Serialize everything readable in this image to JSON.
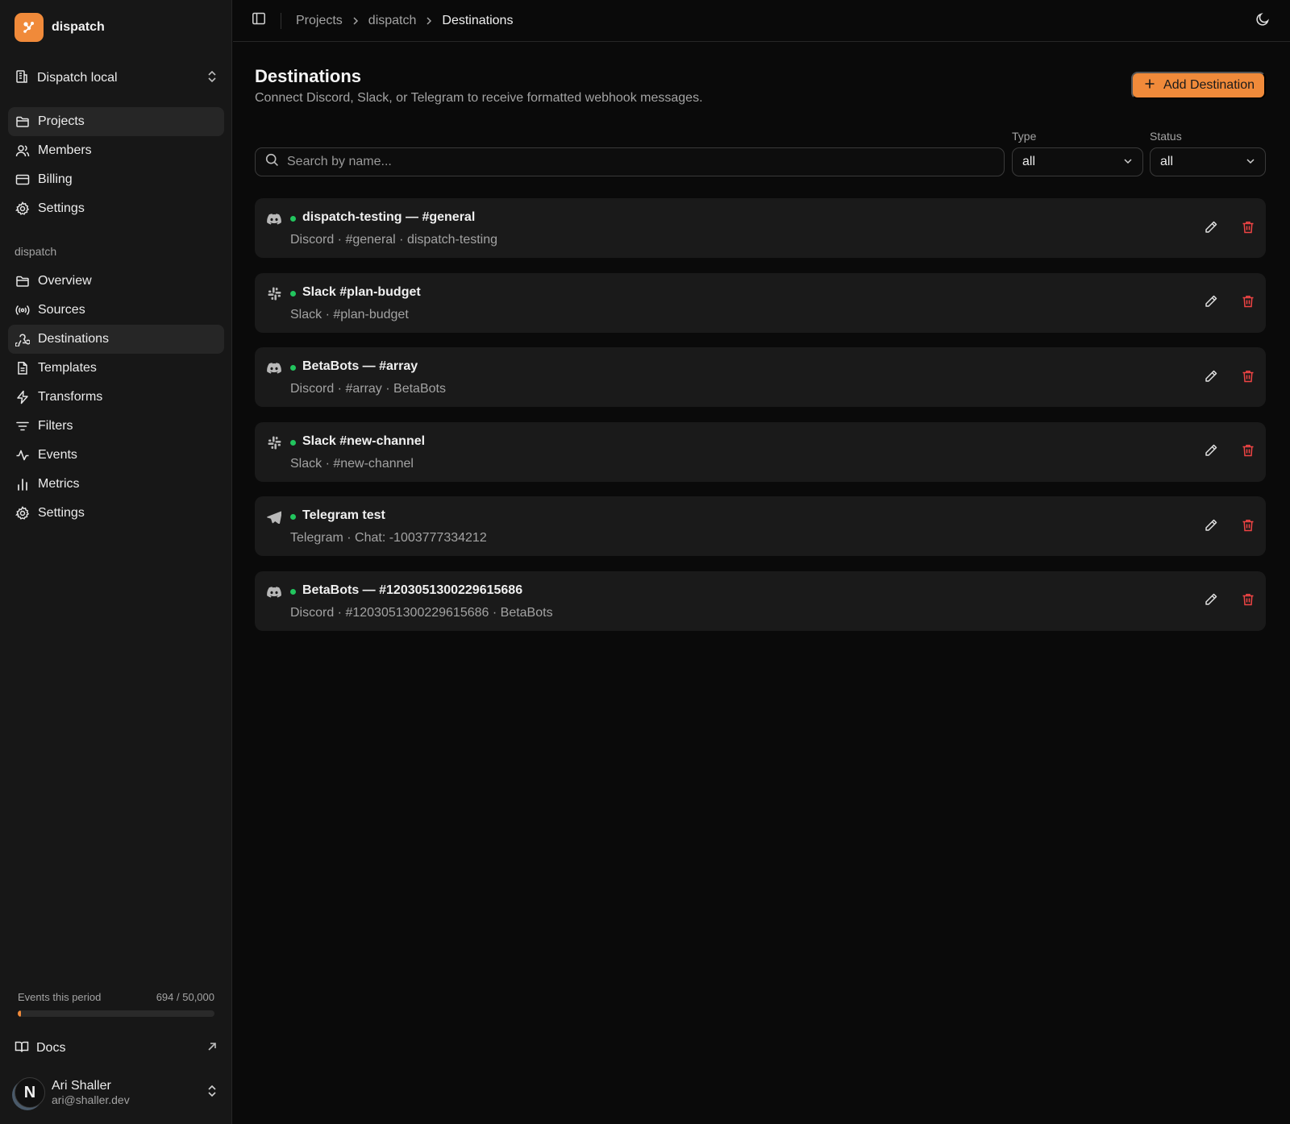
{
  "brand": {
    "name": "dispatch",
    "accent": "#f08a3a"
  },
  "workspace": {
    "label": "Dispatch local"
  },
  "nav_top": [
    {
      "label": "Projects",
      "icon": "folder-icon",
      "active": true
    },
    {
      "label": "Members",
      "icon": "users-icon",
      "active": false
    },
    {
      "label": "Billing",
      "icon": "credit-card-icon",
      "active": false
    },
    {
      "label": "Settings",
      "icon": "gear-icon",
      "active": false
    }
  ],
  "project_group_label": "dispatch",
  "nav_project": [
    {
      "label": "Overview",
      "icon": "folder-icon",
      "active": false
    },
    {
      "label": "Sources",
      "icon": "broadcast-icon",
      "active": false
    },
    {
      "label": "Destinations",
      "icon": "webhook-icon",
      "active": true
    },
    {
      "label": "Templates",
      "icon": "file-text-icon",
      "active": false
    },
    {
      "label": "Transforms",
      "icon": "bolt-icon",
      "active": false
    },
    {
      "label": "Filters",
      "icon": "filter-icon",
      "active": false
    },
    {
      "label": "Events",
      "icon": "activity-icon",
      "active": false
    },
    {
      "label": "Metrics",
      "icon": "bar-chart-icon",
      "active": false
    },
    {
      "label": "Settings",
      "icon": "gear-icon",
      "active": false
    }
  ],
  "usage": {
    "label": "Events this period",
    "value_text": "694 / 50,000",
    "used": 694,
    "limit": 50000
  },
  "docs": {
    "label": "Docs"
  },
  "user": {
    "initial": "N",
    "name": "Ari Shaller",
    "email": "ari@shaller.dev"
  },
  "breadcrumb": [
    "Projects",
    "dispatch",
    "Destinations"
  ],
  "page": {
    "title": "Destinations",
    "subtitle": "Connect Discord, Slack, or Telegram to receive formatted webhook messages.",
    "add_label": "Add Destination"
  },
  "filters": {
    "search_placeholder": "Search by name...",
    "type_label": "Type",
    "type_value": "all",
    "status_label": "Status",
    "status_value": "all"
  },
  "status_color": "#22c55e",
  "danger_color": "#ef4444",
  "destinations": [
    {
      "type": "discord",
      "icon": "discord-icon",
      "title": "dispatch-testing — #general",
      "meta": "Discord · #general · dispatch-testing"
    },
    {
      "type": "slack",
      "icon": "slack-icon",
      "title": "Slack #plan-budget",
      "meta": "Slack · #plan-budget"
    },
    {
      "type": "discord",
      "icon": "discord-icon",
      "title": "BetaBots — #array",
      "meta": "Discord · #array · BetaBots"
    },
    {
      "type": "slack",
      "icon": "slack-icon",
      "title": "Slack #new-channel",
      "meta": "Slack · #new-channel"
    },
    {
      "type": "telegram",
      "icon": "telegram-icon",
      "title": "Telegram test",
      "meta": "Telegram · Chat: -1003777334212"
    },
    {
      "type": "discord",
      "icon": "discord-icon",
      "title": "BetaBots — #1203051300229615686",
      "meta": "Discord · #1203051300229615686 · BetaBots"
    }
  ]
}
